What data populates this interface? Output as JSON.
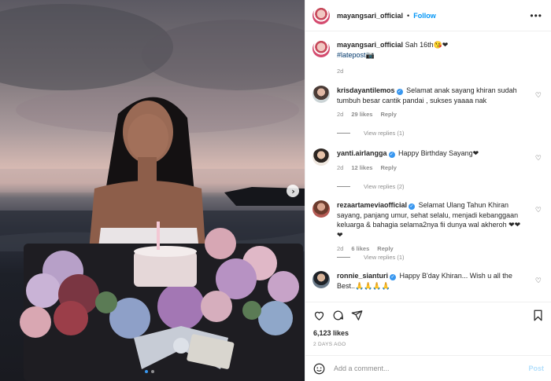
{
  "post": {
    "username": "mayangsari_official",
    "follow_label": "Follow",
    "more_label": "•••",
    "caption_text": "Sah 16th😘❤",
    "caption_hashtag": "#latepost📷",
    "caption_time": "2d"
  },
  "comments": [
    {
      "username": "krisdayantilemos",
      "verified": true,
      "text": "Selamat anak sayang khiran sudah tumbuh besar cantik pandai , sukses yaaaa nak",
      "time": "2d",
      "likes": "29 likes",
      "reply_label": "Reply",
      "view_replies": "View replies (1)"
    },
    {
      "username": "yanti.airlangga",
      "verified": true,
      "text": "Happy Birthday Sayang❤",
      "time": "2d",
      "likes": "12 likes",
      "reply_label": "Reply",
      "view_replies": "View replies (2)"
    },
    {
      "username": "rezaartameviaofficial",
      "verified": true,
      "text": "Selamat Ulang Tahun Khiran sayang, panjang umur, sehat selalu, menjadi kebanggaan keluarga & bahagia selama2nya fii dunya wal akheroh ❤❤❤",
      "time": "2d",
      "likes": "6 likes",
      "reply_label": "Reply",
      "view_replies": "View replies (1)"
    },
    {
      "username": "ronnie_sianturi",
      "verified": true,
      "text": "Happy B'day Khiran... Wish u all the Best..🙏🙏🙏🙏",
      "time": "",
      "likes": "",
      "reply_label": "",
      "view_replies": ""
    }
  ],
  "footer": {
    "likes": "6,123 likes",
    "timestamp": "2 DAYS AGO",
    "add_comment_placeholder": "Add a comment...",
    "post_label": "Post"
  },
  "icons": [
    "heart-icon",
    "comment-icon",
    "share-icon",
    "bookmark-icon",
    "emoji-icon",
    "more-icon",
    "chevron-right-icon",
    "verified-icon"
  ],
  "colors": {
    "accent": "#0095f6",
    "verified": "#3897f0",
    "muted": "#8e8e8e",
    "post_disabled": "#b2dffc"
  }
}
